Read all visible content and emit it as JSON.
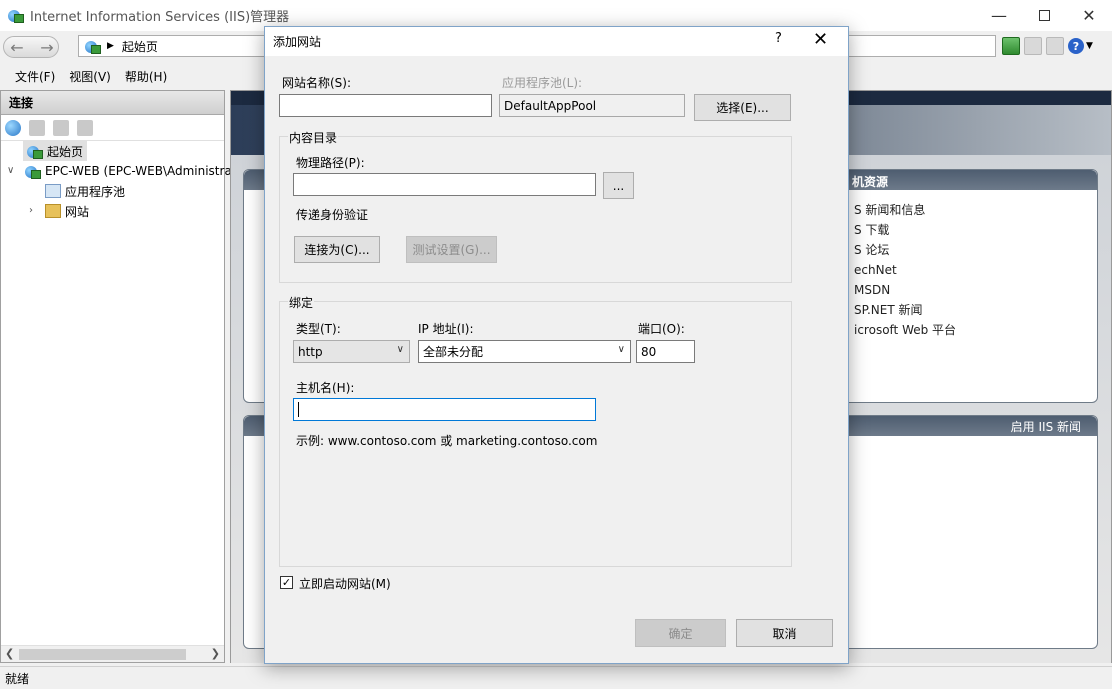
{
  "window": {
    "title": "Internet Information Services (IIS)管理器",
    "address": "起始页"
  },
  "menu": {
    "file": "文件(F)",
    "view": "视图(V)",
    "help": "帮助(H)"
  },
  "connections": {
    "header": "连接",
    "tree": [
      {
        "label": "起始页"
      },
      {
        "label": "EPC-WEB (EPC-WEB\\Administrator)"
      },
      {
        "label": "应用程序池"
      },
      {
        "label": "网站"
      }
    ]
  },
  "start_page": {
    "resources_title": "机资源",
    "resources": [
      "S 新闻和信息",
      "S 下载",
      "S 论坛",
      "echNet",
      "MSDN",
      "SP.NET 新闻",
      "icrosoft Web 平台"
    ],
    "news_toggle": "启用 IIS 新闻"
  },
  "status": "就绪",
  "dialog": {
    "title": "添加网站",
    "help": "?",
    "site_name_label": "网站名称(S):",
    "site_name_value": "",
    "app_pool_label": "应用程序池(L):",
    "app_pool_value": "DefaultAppPool",
    "select_button": "选择(E)...",
    "content_dir_group": "内容目录",
    "physical_path_label": "物理路径(P):",
    "physical_path_value": "",
    "browse_button": "...",
    "pass_through_label": "传递身份验证",
    "connect_as_button": "连接为(C)...",
    "test_settings_button": "测试设置(G)...",
    "binding_group": "绑定",
    "type_label": "类型(T):",
    "type_value": "http",
    "ip_label": "IP 地址(I):",
    "ip_value": "全部未分配",
    "port_label": "端口(O):",
    "port_value": "80",
    "host_label": "主机名(H):",
    "host_value": "",
    "example_text": "示例: www.contoso.com 或 marketing.contoso.com",
    "start_now_label": "立即启动网站(M)",
    "start_now_checked": true,
    "ok_button": "确定",
    "cancel_button": "取消"
  }
}
